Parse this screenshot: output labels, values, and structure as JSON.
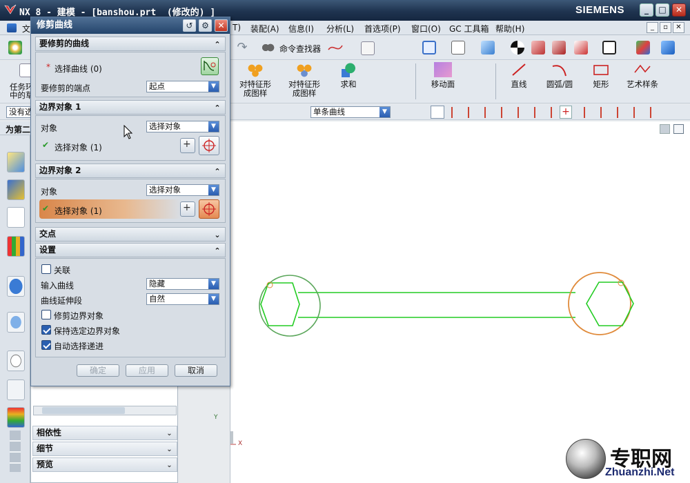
{
  "window": {
    "title": "NX 8 - 建模 - [banshou.prt  (修改的) ]",
    "brand": "SIEMENS",
    "controls": [
      "_",
      "□",
      "✕"
    ]
  },
  "menubar": {
    "items": [
      "文",
      "T)",
      "装配(A)",
      "信息(I)",
      "分析(L)",
      "首选项(P)",
      "窗口(O)",
      "GC 工具箱",
      "帮助(H)"
    ]
  },
  "toolbar": {
    "command_finder": "命令查找器",
    "tools": [
      "对特征形\n成图样",
      "对特征形\n成图样",
      "求和",
      "移动面",
      "直线",
      "圆弧/圆",
      "矩形",
      "艺术样条"
    ],
    "left_task_label": "任务环\n中的草",
    "filter_left": "没有选",
    "curve_rule": "单条曲线"
  },
  "navigator": {
    "title_fragment": "为第二",
    "sections": [
      "相依性",
      "细节",
      "预览"
    ]
  },
  "dialog": {
    "title": "修剪曲线",
    "group1": {
      "header": "要修剪的曲线",
      "select_curve": "选择曲线 (0)",
      "endpoint_label": "要修剪的端点",
      "endpoint_value": "起点"
    },
    "group2": {
      "header": "边界对象 1",
      "object_label": "对象",
      "object_value": "选择对象",
      "select_label": "选择对象 (1)"
    },
    "group3": {
      "header": "边界对象 2",
      "object_label": "对象",
      "object_value": "选择对象",
      "select_label": "选择对象 (1)"
    },
    "intersection_header": "交点",
    "settings": {
      "header": "设置",
      "associative": "关联",
      "input_curve_label": "输入曲线",
      "input_curve_value": "隐藏",
      "extension_label": "曲线延伸段",
      "extension_value": "自然",
      "trim_boundary": "修剪边界对象",
      "keep_boundary": "保持选定边界对象",
      "auto_advance": "自动选择递进",
      "checks": {
        "associative": false,
        "trim_boundary": false,
        "keep_boundary": true,
        "auto_advance": true
      }
    },
    "buttons": {
      "ok": "确定",
      "apply": "应用",
      "cancel": "取消"
    }
  },
  "triad": {
    "y": "Y",
    "x": "X"
  },
  "watermark": {
    "text": "专职网",
    "url": "Zhuanzhi.Net"
  },
  "colors": {
    "curve": "#22cc22",
    "boundary1": "#5aa65a",
    "boundary2": "#e08a3a",
    "title": "#24456c"
  }
}
